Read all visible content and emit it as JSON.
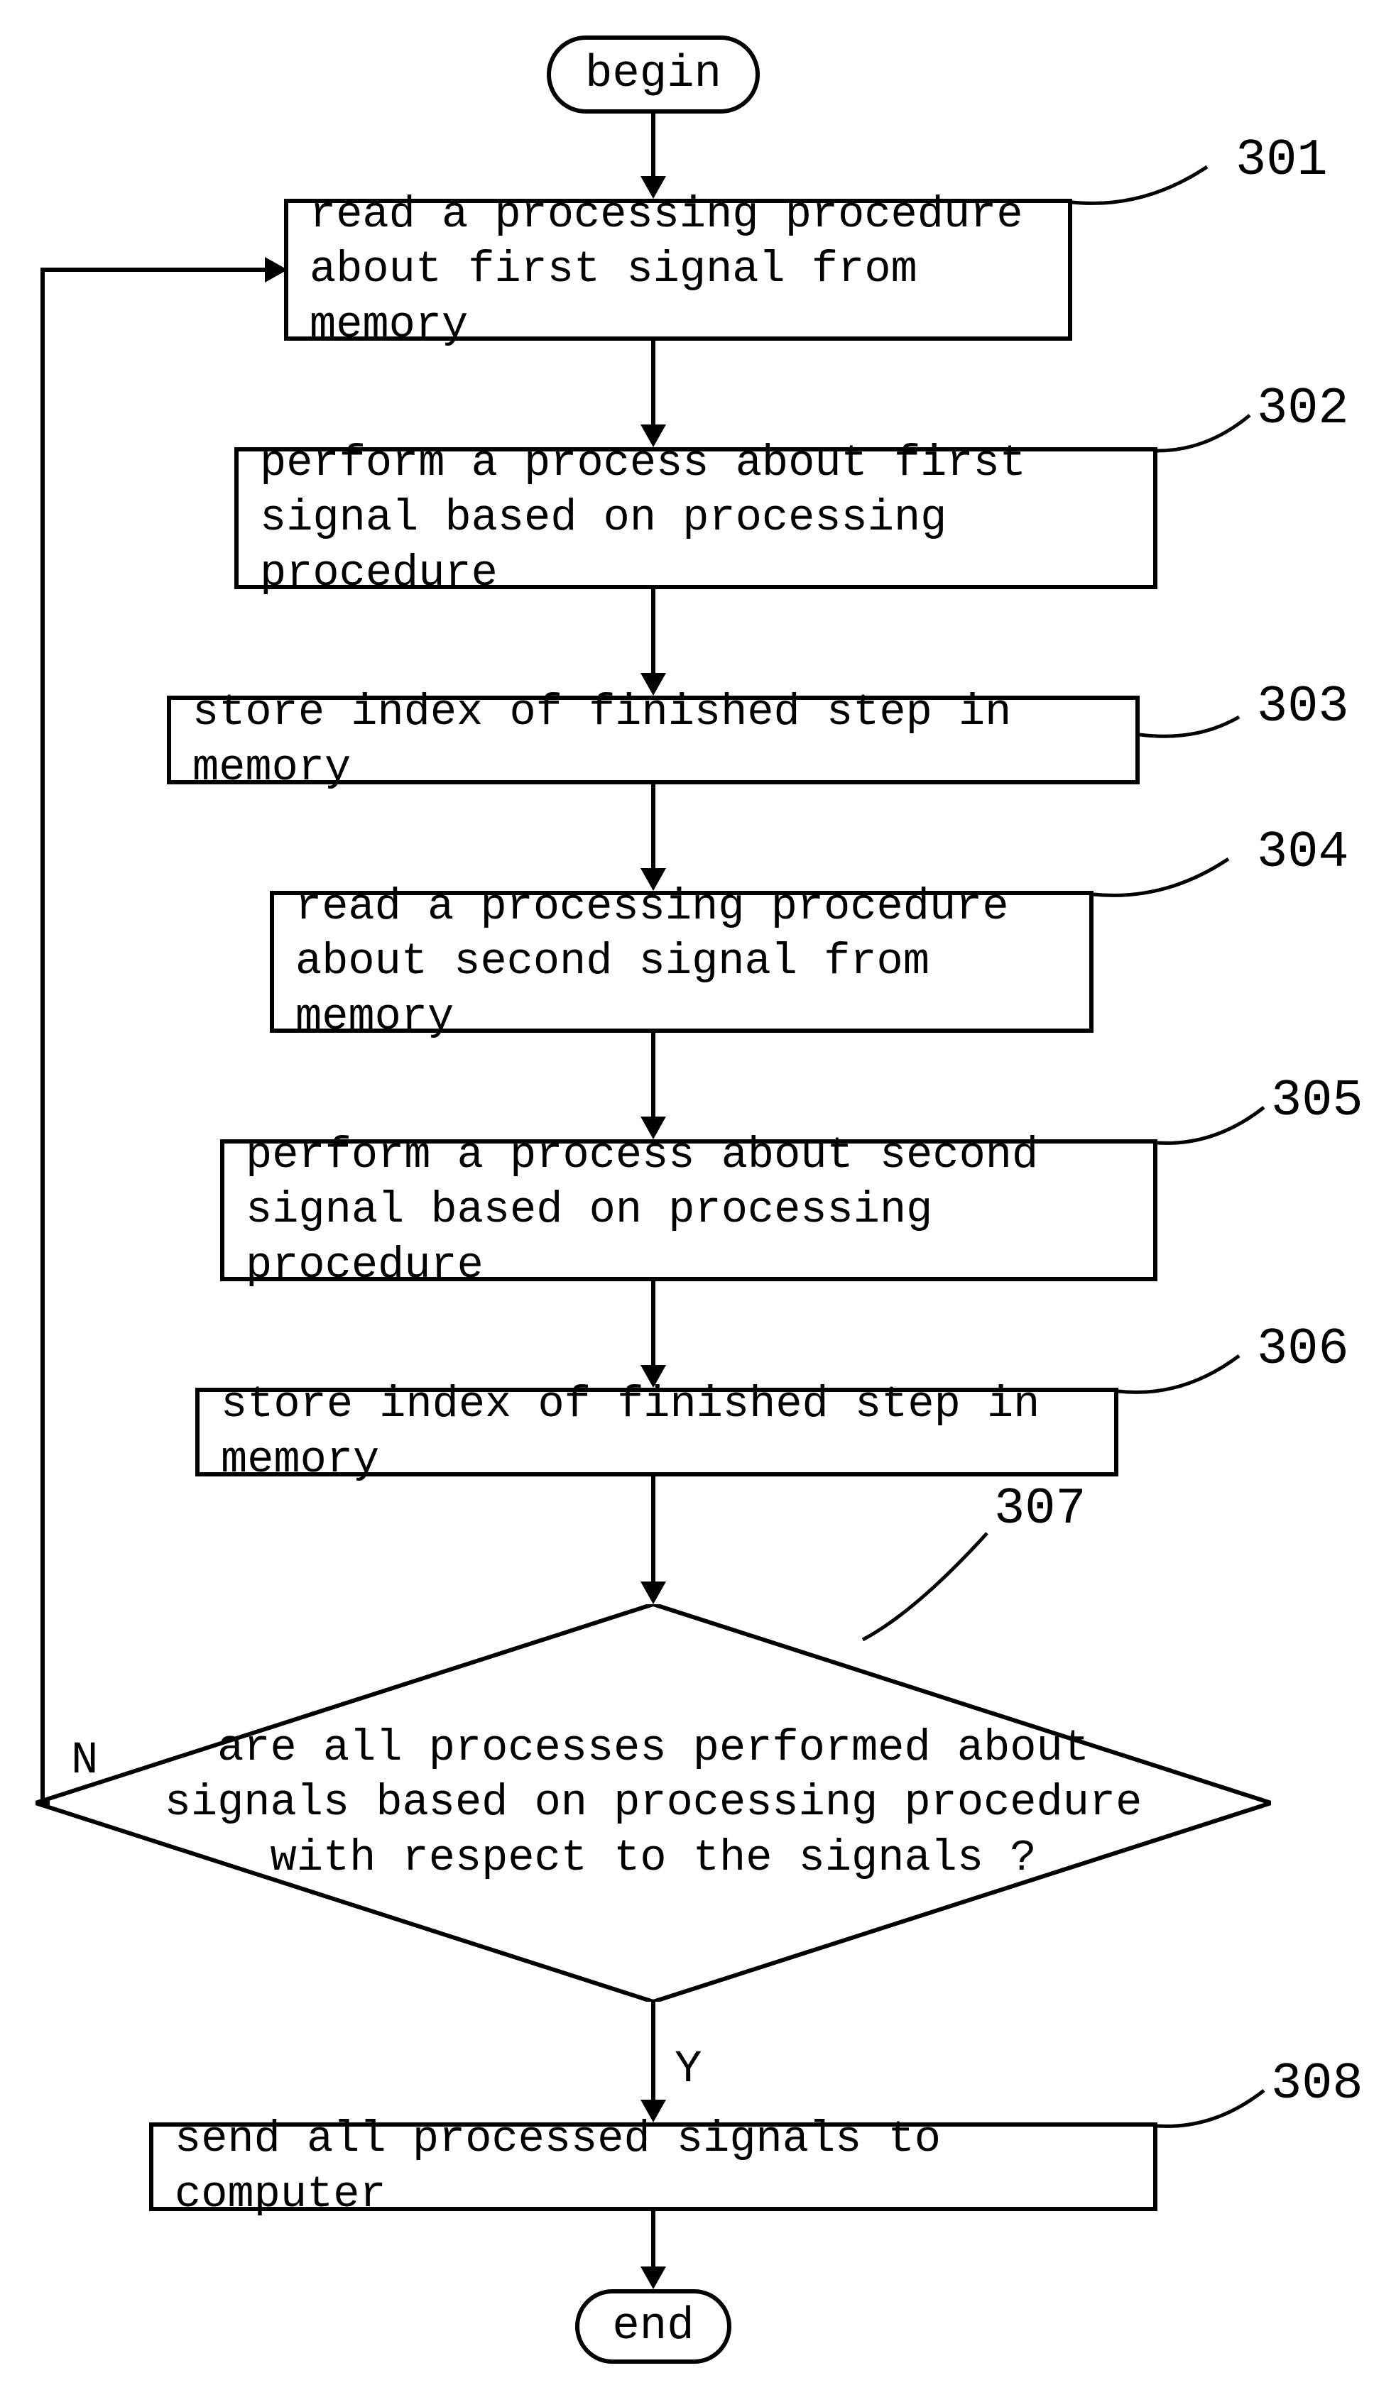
{
  "start": "begin",
  "end": "end",
  "steps": {
    "s301": "read a processing procedure\nabout first signal from memory",
    "s302": "perform a process about first\nsignal based on processing procedure",
    "s303": "store index of finished step in memory",
    "s304": "read a processing procedure\nabout second signal from memory",
    "s305": "perform a process about second\nsignal based on processing procedure",
    "s306": "store index of finished step in memory",
    "s307": "are all processes performed about\nsignals based on processing procedure\nwith respect to the signals ?",
    "s308": "send all processed signals to computer"
  },
  "labels": {
    "n301": "301",
    "n302": "302",
    "n303": "303",
    "n304": "304",
    "n305": "305",
    "n306": "306",
    "n307": "307",
    "n308": "308",
    "no": "N",
    "yes": "Y"
  }
}
